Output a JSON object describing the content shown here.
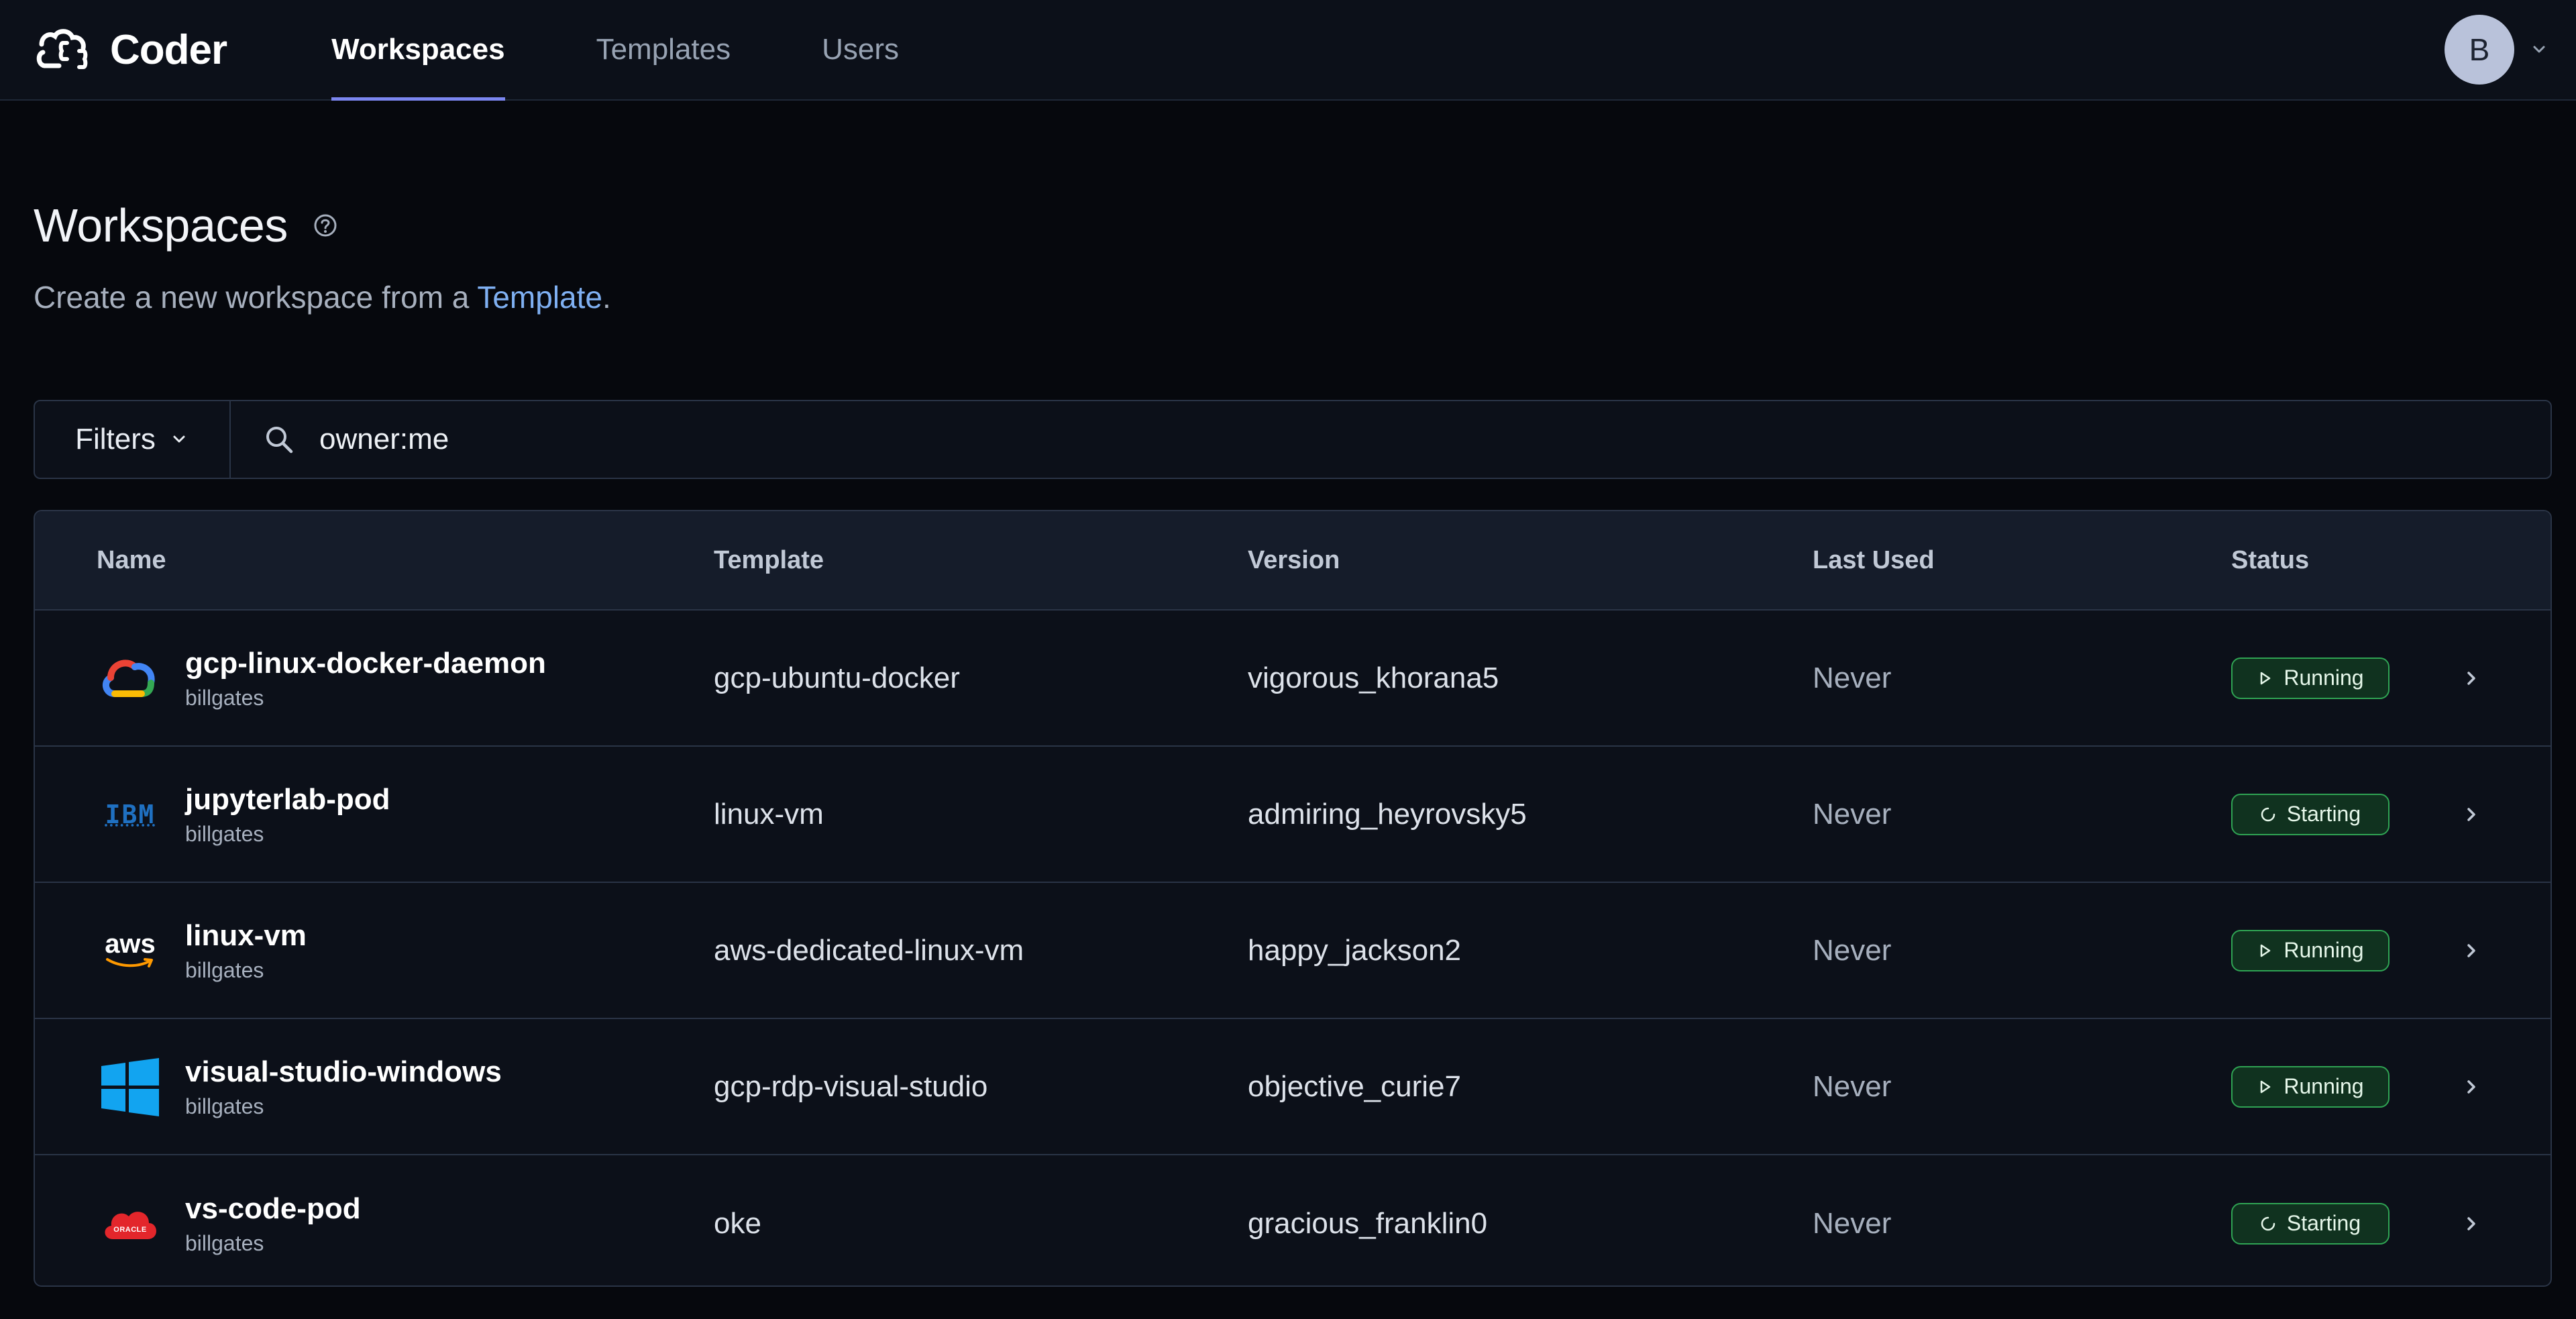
{
  "app": {
    "brand_name": "Coder"
  },
  "nav": {
    "items": [
      {
        "label": "Workspaces",
        "active": true
      },
      {
        "label": "Templates",
        "active": false
      },
      {
        "label": "Users",
        "active": false
      }
    ],
    "user_initial": "B"
  },
  "header": {
    "title": "Workspaces",
    "subtitle_prefix": "Create a new workspace from a ",
    "subtitle_link": "Template",
    "subtitle_suffix": "."
  },
  "filters": {
    "button_label": "Filters",
    "query": "owner:me"
  },
  "table": {
    "columns": [
      "Name",
      "Template",
      "Version",
      "Last Used",
      "Status"
    ],
    "rows": [
      {
        "icon": "google-cloud-icon",
        "name": "gcp-linux-docker-daemon",
        "owner": "billgates",
        "template": "gcp-ubuntu-docker",
        "version": "vigorous_khorana5",
        "last_used": "Never",
        "status": "Running"
      },
      {
        "icon": "ibm-icon",
        "name": "jupyterlab-pod",
        "owner": "billgates",
        "template": "linux-vm",
        "version": "admiring_heyrovsky5",
        "last_used": "Never",
        "status": "Starting"
      },
      {
        "icon": "aws-icon",
        "name": "linux-vm",
        "owner": "billgates",
        "template": "aws-dedicated-linux-vm",
        "version": "happy_jackson2",
        "last_used": "Never",
        "status": "Running"
      },
      {
        "icon": "windows-icon",
        "name": "visual-studio-windows",
        "owner": "billgates",
        "template": "gcp-rdp-visual-studio",
        "version": "objective_curie7",
        "last_used": "Never",
        "status": "Running"
      },
      {
        "icon": "oracle-cloud-icon",
        "name": "vs-code-pod",
        "owner": "billgates",
        "template": "oke",
        "version": "gracious_franklin0",
        "last_used": "Never",
        "status": "Starting"
      }
    ]
  },
  "colors": {
    "background": "#06080d",
    "nav_background": "#0c1019",
    "accent": "#7b86f0",
    "link": "#7fb0f2",
    "status_green": "#2fa353",
    "status_green_bg": "#10321f"
  },
  "icon_glyphs": {
    "ibm_logo": "IBM",
    "aws_logo": "aws",
    "oracle_logo": "ORACLE"
  }
}
